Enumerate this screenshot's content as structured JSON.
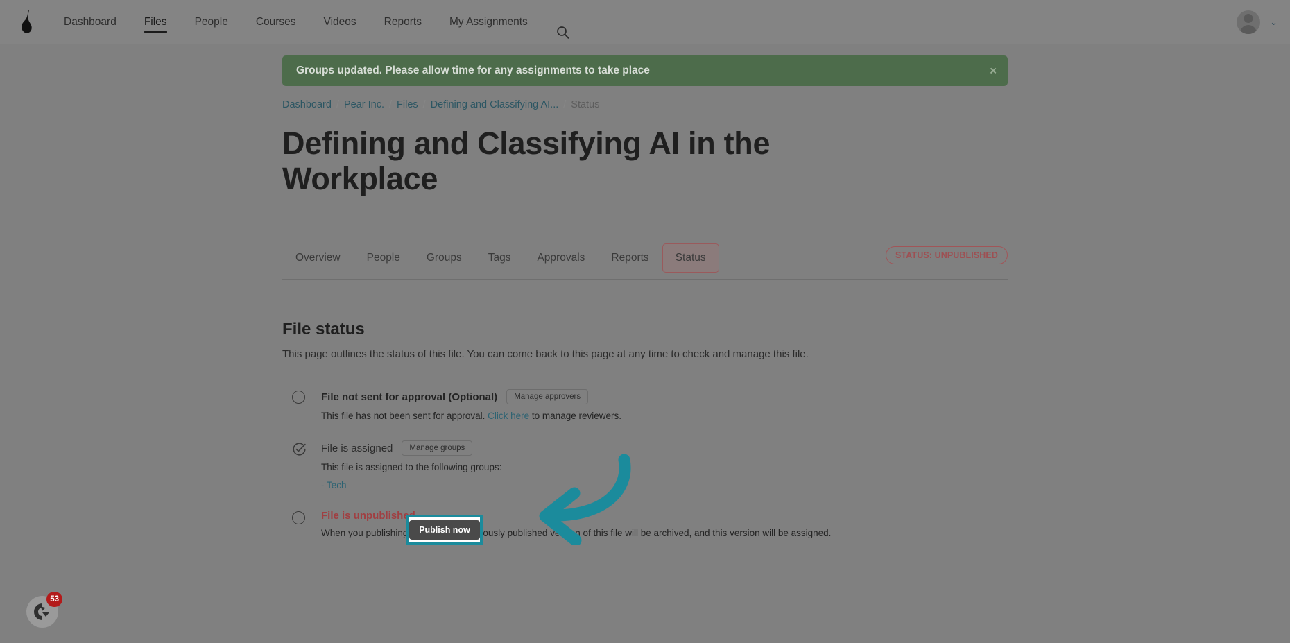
{
  "topnav": {
    "logo_icon": "pear-logo-icon",
    "links": [
      {
        "label": "Dashboard",
        "active": false
      },
      {
        "label": "Files",
        "active": true
      },
      {
        "label": "People",
        "active": false
      },
      {
        "label": "Courses",
        "active": false
      },
      {
        "label": "Videos",
        "active": false
      },
      {
        "label": "Reports",
        "active": false
      },
      {
        "label": "My Assignments",
        "active": false
      }
    ],
    "search_icon": "search-icon",
    "avatar_icon": "user-avatar-icon",
    "caret": "⌄"
  },
  "alert": {
    "message": "Groups updated. Please allow time for any assignments to take place",
    "close_label": "×",
    "color": "#4d6c4b"
  },
  "breadcrumb": {
    "items": [
      "Dashboard",
      "Pear Inc.",
      "Files",
      "Defining and Classifying AI...",
      "Status"
    ],
    "separator": "/"
  },
  "page": {
    "title": "Defining and Classifying AI in the Workplace"
  },
  "tabs": {
    "items": [
      {
        "label": "Overview",
        "selected": false
      },
      {
        "label": "People",
        "selected": false
      },
      {
        "label": "Groups",
        "selected": false
      },
      {
        "label": "Tags",
        "selected": false
      },
      {
        "label": "Approvals",
        "selected": false
      },
      {
        "label": "Reports",
        "selected": false
      },
      {
        "label": "Status",
        "selected": true
      }
    ],
    "status_pill": "STATUS: UNPUBLISHED",
    "status_pill_color": "#9e4f52"
  },
  "section": {
    "heading": "File status",
    "description": "This page outlines the status of this file. You can come back to this page at any time to check and manage this file."
  },
  "status_items": [
    {
      "icon": "empty-circle-icon",
      "title": "File not sent for approval (Optional)",
      "chip": "Manage approvers",
      "desc_before": "This file has not been sent for approval. ",
      "desc_link": "Click here",
      "desc_after": " to manage reviewers.",
      "danger": false
    },
    {
      "icon": "check-circle-icon",
      "title": "File is assigned",
      "chip": "Manage groups",
      "desc_before": "This file is assigned to the following groups:",
      "desc_link": "",
      "desc_after": "",
      "groups": "- Tech",
      "danger": false
    },
    {
      "icon": "empty-circle-icon",
      "title": "File is unpublished",
      "chip": "",
      "desc_before": "When you publishing this file, any previously published version of this file will be archived, and this version will be assigned.",
      "desc_link": "",
      "desc_after": "",
      "danger": true
    }
  ],
  "highlight": {
    "publish_label": "Publish now",
    "border_color": "#1b8b9c"
  },
  "annotation": {
    "arrow_color": "#1b8b9c",
    "arrow_icon": "curved-left-arrow-icon"
  },
  "chat_widget": {
    "icon": "chat-bubble-icon",
    "badge": "53",
    "badge_color": "#b31a1a"
  }
}
